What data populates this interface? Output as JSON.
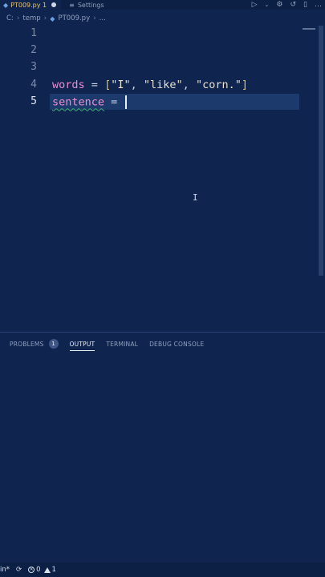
{
  "tabs": [
    {
      "label": "PT009.py 1",
      "active": true,
      "modified": true
    },
    {
      "label": "Settings",
      "active": false
    }
  ],
  "tab_actions": [
    "run-icon",
    "chevron-down-icon",
    "gear-icon",
    "history-icon",
    "split-editor-icon",
    "more-icon"
  ],
  "breadcrumb": {
    "drive": "C:",
    "folder": "temp",
    "file": "PT009.py",
    "more": "..."
  },
  "editor": {
    "line_numbers": [
      "1",
      "2",
      "3",
      "4",
      "5"
    ],
    "line4": {
      "var": "words",
      "eq": "=",
      "open": "[",
      "s1": "\"I\"",
      "c1": ",",
      "s2": "\"like\"",
      "c2": ",",
      "s3": "\"corn.\"",
      "close": "]"
    },
    "line5": {
      "var": "sentence",
      "eq": "="
    }
  },
  "panel": {
    "tabs": [
      {
        "label": "PROBLEMS",
        "badge": "1",
        "active": false
      },
      {
        "label": "OUTPUT",
        "active": true
      },
      {
        "label": "TERMINAL",
        "active": false
      },
      {
        "label": "DEBUG CONSOLE",
        "active": false
      }
    ]
  },
  "statusbar": {
    "left": "in*",
    "errors": "0",
    "warnings": "1"
  },
  "colors": {
    "background": "#0f2550",
    "keyword_var": "#f08bd0",
    "bracket": "#e8c24a",
    "current_line": "#1c3b6c"
  }
}
